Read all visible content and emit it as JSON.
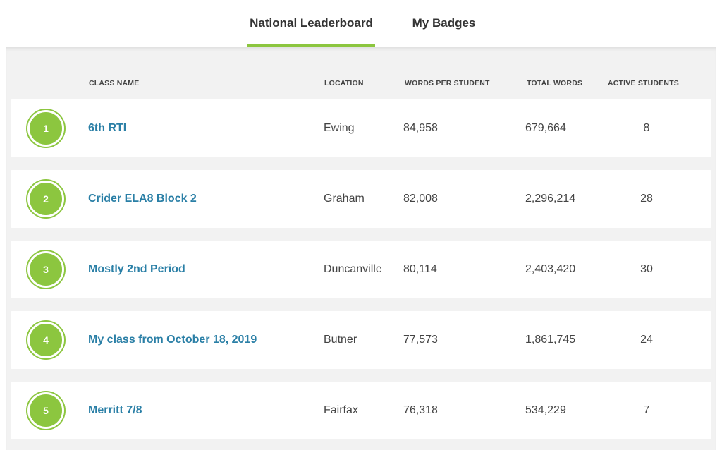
{
  "tabs": [
    {
      "label": "National Leaderboard",
      "active": true
    },
    {
      "label": "My Badges",
      "active": false
    }
  ],
  "table": {
    "columns": {
      "class_name": "CLASS NAME",
      "location": "LOCATION",
      "words_per_student": "WORDS PER STUDENT",
      "total_words": "TOTAL WORDS",
      "active_students": "ACTIVE STUDENTS"
    },
    "rows": [
      {
        "rank": "1",
        "class_name": "6th RTI",
        "location": "Ewing",
        "words_per_student": "84,958",
        "total_words": "679,664",
        "active_students": "8"
      },
      {
        "rank": "2",
        "class_name": "Crider ELA8 Block 2",
        "location": "Graham",
        "words_per_student": "82,008",
        "total_words": "2,296,214",
        "active_students": "28"
      },
      {
        "rank": "3",
        "class_name": "Mostly 2nd Period",
        "location": "Duncanville",
        "words_per_student": "80,114",
        "total_words": "2,403,420",
        "active_students": "30"
      },
      {
        "rank": "4",
        "class_name": "My class from October 18, 2019",
        "location": "Butner",
        "words_per_student": "77,573",
        "total_words": "1,861,745",
        "active_students": "24"
      },
      {
        "rank": "5",
        "class_name": "Merritt 7/8",
        "location": "Fairfax",
        "words_per_student": "76,318",
        "total_words": "534,229",
        "active_students": "7"
      }
    ]
  },
  "colors": {
    "accent": "#8cc63f",
    "link": "#2a7fa6",
    "panel": "#f2f2f2"
  }
}
